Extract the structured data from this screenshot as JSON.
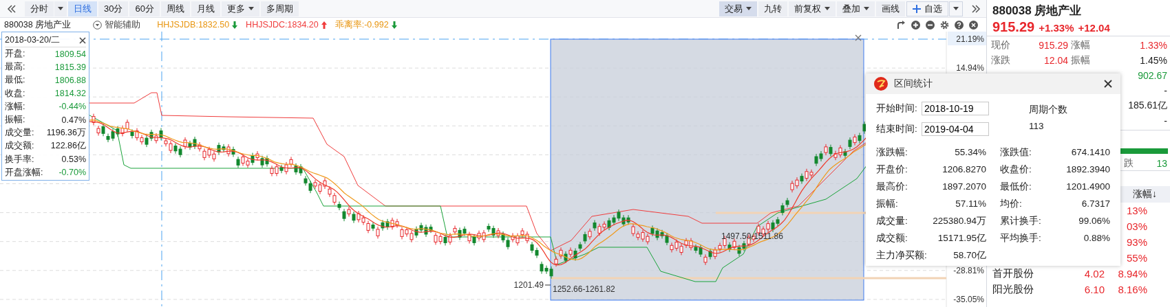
{
  "toolbar": {
    "left": [
      {
        "label": "分时",
        "dropdown": true,
        "separate_menu": true,
        "selected": false
      },
      {
        "label": "日线",
        "selected": true
      },
      {
        "label": "30分",
        "selected": false
      },
      {
        "label": "60分",
        "selected": false
      },
      {
        "label": "周线",
        "selected": false
      },
      {
        "label": "月线",
        "selected": false
      },
      {
        "label": "更多",
        "dropdown": true,
        "selected": false
      },
      {
        "label": "多周期",
        "selected": false
      }
    ],
    "right": [
      {
        "label": "交易",
        "dropdown": true,
        "active": true
      },
      {
        "label": "九转",
        "active": false
      },
      {
        "label": "前复权",
        "dropdown": true,
        "active": false
      },
      {
        "label": "叠加",
        "dropdown": true,
        "active": false
      },
      {
        "label": "画线",
        "active": false
      },
      {
        "label": "自选",
        "kind": "plus",
        "dropdown": true,
        "separate_menu": true,
        "active": false
      }
    ]
  },
  "info_bar": {
    "symbol": "880038 房地产业",
    "assist_label": "智能辅助",
    "indicators": [
      {
        "text": "HHJSJDB:1832.50",
        "color": "#e8950f",
        "rising": false
      },
      {
        "text": "HHJSJDC:1834.20",
        "color": "#f03c3c",
        "rising": true
      },
      {
        "text": "乖离率:-0.992",
        "color": "#e8950f",
        "rising": false
      }
    ]
  },
  "tooltip": {
    "date": "2018-03-20/二",
    "rows": [
      {
        "label": "开盘:",
        "value": "1809.54",
        "color": "#1a9a3a"
      },
      {
        "label": "最高:",
        "value": "1815.39",
        "color": "#1a9a3a"
      },
      {
        "label": "最低:",
        "value": "1806.88",
        "color": "#1a9a3a"
      },
      {
        "label": "收盘:",
        "value": "1814.32",
        "color": "#1a9a3a"
      },
      {
        "label": "涨幅:",
        "value": "-0.44%",
        "color": "#1a9a3a"
      },
      {
        "label": "振幅:",
        "value": "0.47%",
        "color": "#222222"
      },
      {
        "label": "成交量:",
        "value": "1196.36万",
        "color": "#222222"
      },
      {
        "label": "成交额:",
        "value": "122.86亿",
        "color": "#222222"
      },
      {
        "label": "换手率:",
        "value": "0.53%",
        "color": "#222222"
      },
      {
        "label": "开盘涨幅:",
        "value": "-0.70%",
        "color": "#1a9a3a"
      }
    ]
  },
  "chart": {
    "axis_labels": [
      "21.19%",
      "14.94%",
      "-28.81%",
      "-35.05%"
    ],
    "annotations": [
      "1201.49",
      "1252.66-1261.82",
      "1497.50-1511.86"
    ]
  },
  "dialog": {
    "title": "区间统计",
    "start_label": "开始时间:",
    "start_value": "2018-10-19",
    "end_label": "结束时间:",
    "end_value": "2019-04-04",
    "period_label": "周期个数",
    "period_value": "113",
    "stats": [
      {
        "label": "涨跌幅:",
        "value": "55.34%",
        "label2": "涨跌值:",
        "value2": "674.1410"
      },
      {
        "label": "开盘价:",
        "value": "1206.8270",
        "label2": "收盘价:",
        "value2": "1892.3940"
      },
      {
        "label": "最高价:",
        "value": "1897.2070",
        "label2": "最低价:",
        "value2": "1201.4900"
      },
      {
        "label": "振幅:",
        "value": "57.11%",
        "label2": "均价:",
        "value2": "6.7317"
      },
      {
        "label": "成交量:",
        "value": "225380.94万",
        "label2": "累计换手:",
        "value2": "99.06%"
      },
      {
        "label": "成交额:",
        "value": "15171.95亿",
        "label2": "平均换手:",
        "value2": "0.88%"
      },
      {
        "label": "主力净买额:",
        "value": "58.70亿"
      }
    ]
  },
  "quote": {
    "title": "880038 房地产业",
    "price": "915.29",
    "change_pct": "+1.33%",
    "change": "+12.04",
    "rows": [
      {
        "left": {
          "label": "现价",
          "value": "915.29",
          "color": "#e8262b"
        },
        "right": {
          "label": "涨幅",
          "value": "1.33%",
          "color": "#e8262b"
        }
      },
      {
        "left": {
          "label": "涨跌",
          "value": "12.04",
          "color": "#e8262b"
        },
        "right": {
          "label": "振幅",
          "value": "1.45%",
          "color": "#222222"
        }
      },
      {
        "right": {
          "value": "902.67",
          "color": "#1a9a3a"
        }
      },
      {
        "right": {
          "value": "-",
          "color": "#222222"
        }
      },
      {
        "right": {
          "value": "185.61亿",
          "color": "#222222"
        }
      },
      {
        "right": {
          "value": "-",
          "color": "#222222"
        }
      }
    ],
    "breadth_label": "跌",
    "breadth_value": "13"
  },
  "ranking": {
    "header": "涨幅↓",
    "rows": [
      {
        "pct": "13%"
      },
      {
        "pct": "03%"
      },
      {
        "pct": "93%"
      },
      {
        "pct": "55%"
      },
      {
        "name": "首开股份",
        "price": "4.02",
        "pct": "8.94%"
      },
      {
        "name": "阳光股份",
        "price": "6.10",
        "pct": "8.16%"
      }
    ]
  }
}
